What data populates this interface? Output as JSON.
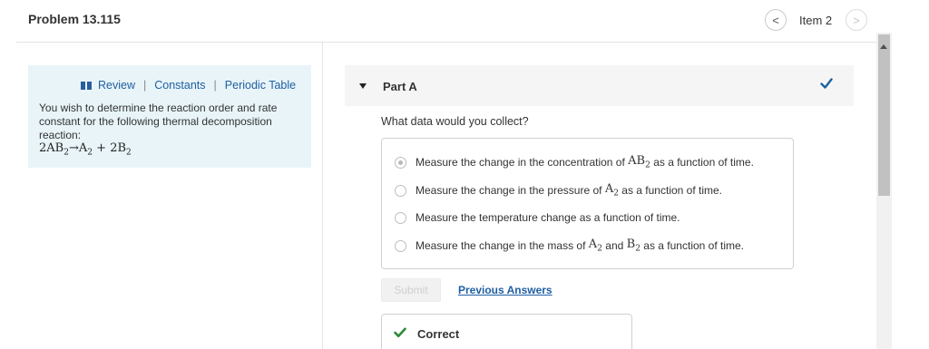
{
  "header": {
    "title": "Problem 13.115",
    "nav_prev_symbol": "<",
    "nav_label": "Item 2",
    "nav_next_symbol": ">"
  },
  "resources": {
    "icon": "book-icon",
    "links": [
      "Review",
      "Constants",
      "Periodic Table"
    ],
    "separator": "|"
  },
  "intro": {
    "text": "You wish to determine the reaction order and rate constant for the following thermal decomposition reaction:",
    "reaction": {
      "lhs_coef": "2",
      "lhs": "AB",
      "lhs_sub": "2",
      "arrow": "→",
      "p1": "A",
      "p1_sub": "2",
      "plus": "+",
      "p2_coef": "2",
      "p2": "B",
      "p2_sub": "2"
    }
  },
  "part": {
    "label": "Part A",
    "status_icon": "check-icon",
    "question": "What data would you collect?"
  },
  "options": {
    "opt1": {
      "pre": "Measure the change in the concentration of",
      "m1": "AB",
      "m1_sub": "2",
      "post": "as a function of time.",
      "selected": true
    },
    "opt2": {
      "pre": "Measure the change in the pressure of",
      "m1": "A",
      "m1_sub": "2",
      "post": "as a function of time.",
      "selected": false
    },
    "opt3": {
      "text": "Measure the temperature change as a function of time.",
      "selected": false
    },
    "opt4": {
      "pre": "Measure the change in the mass of",
      "m1": "A",
      "m1_sub": "2",
      "mid": "and",
      "m2": "B",
      "m2_sub": "2",
      "post": "as a function of time.",
      "selected": false
    }
  },
  "actions": {
    "submit_label": "Submit",
    "previous_answers_label": "Previous Answers"
  },
  "feedback": {
    "label": "Correct",
    "icon": "check-icon"
  },
  "colors": {
    "accent_link": "#1f5fa2",
    "correct_green": "#2c8a3a",
    "panel_bg": "#e8f4f8",
    "part_check": "#1f5fa2"
  }
}
